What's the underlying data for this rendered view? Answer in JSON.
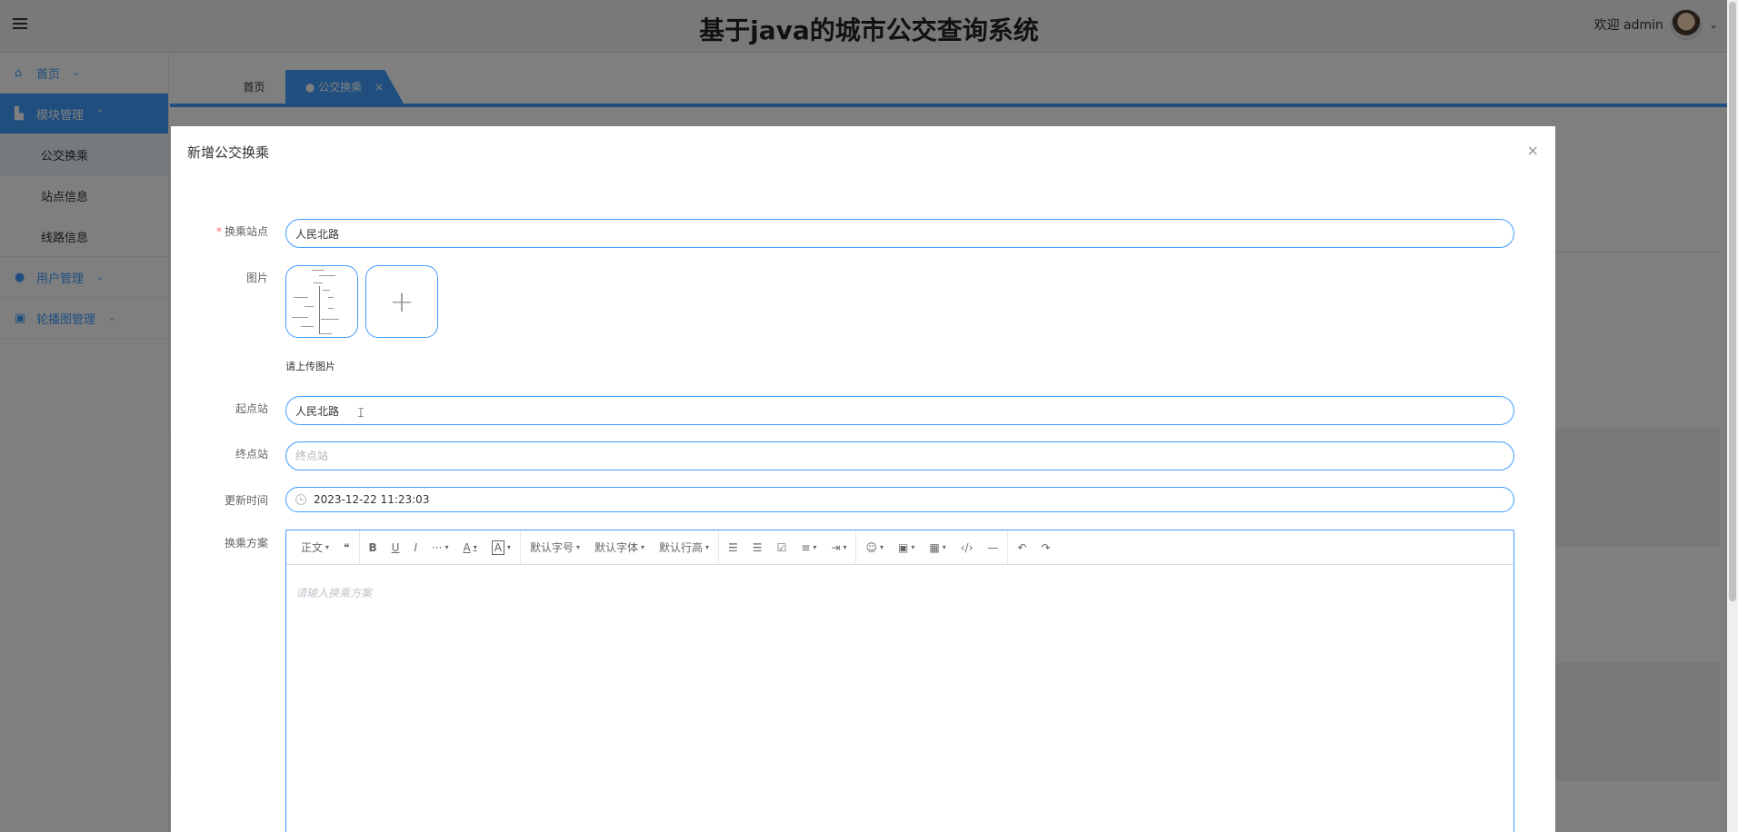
{
  "header": {
    "title": "基于java的城市公交查询系统",
    "welcome": "欢迎 admin"
  },
  "sidebar": {
    "items": [
      {
        "label": "首页",
        "icon": "home-icon"
      },
      {
        "label": "模块管理",
        "icon": "module-icon"
      },
      {
        "label": "公交换乘"
      },
      {
        "label": "站点信息"
      },
      {
        "label": "线路信息"
      },
      {
        "label": "用户管理",
        "icon": "user-icon"
      },
      {
        "label": "轮播图管理",
        "icon": "carousel-icon"
      }
    ]
  },
  "tabs": [
    {
      "label": "首页"
    },
    {
      "label": "● 公交换乘",
      "close": "×"
    }
  ],
  "dialog": {
    "title": "新增公交换乘",
    "close": "×",
    "fields": {
      "transfer_station": {
        "label": "换乘站点",
        "value": "人民北路"
      },
      "image": {
        "label": "图片",
        "hint": "请上传图片",
        "add": "+"
      },
      "start_station": {
        "label": "起点站",
        "value": "人民北路"
      },
      "end_station": {
        "label": "终点站",
        "placeholder": "终点站"
      },
      "update_time": {
        "label": "更新时间",
        "value": "2023-12-22 11:23:03"
      },
      "plan": {
        "label": "换乘方案",
        "placeholder": "请输入换乘方案"
      }
    },
    "toolbar": {
      "paragraph": "正文",
      "quote": "❝",
      "bold": "B",
      "underline": "U",
      "italic": "I",
      "more": "···",
      "font_color": "A",
      "bg_color": "A",
      "font_size": "默认字号",
      "font_family": "默认字体",
      "line_height": "默认行高",
      "bullet_list": "☰",
      "numbered_list": "☰",
      "todo": "☑",
      "align": "≡",
      "indent": "⇥",
      "emoji": "☺",
      "image": "▣",
      "table": "▦",
      "code": "‹/›",
      "divider": "—",
      "undo": "↶",
      "redo": "↷"
    }
  },
  "colors": {
    "primary": "#409eff",
    "overlay": "rgba(0,0,0,0.5)"
  }
}
